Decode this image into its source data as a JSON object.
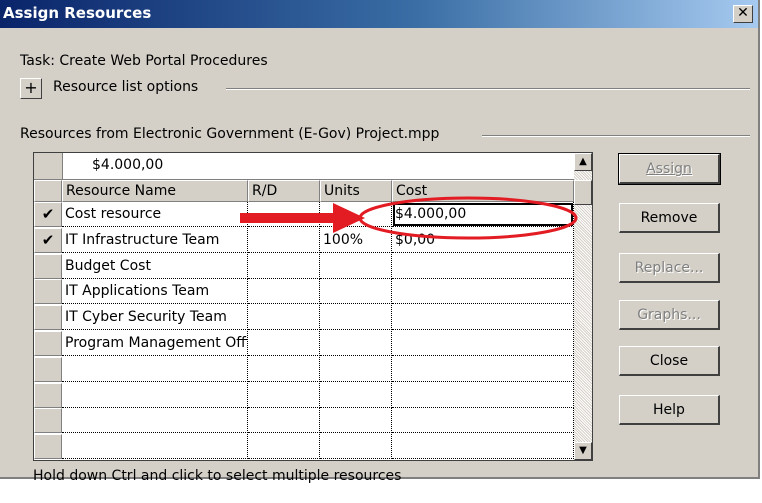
{
  "window": {
    "title": "Assign Resources",
    "close_glyph": "✕"
  },
  "task": {
    "label": "Task: Create Web Portal Procedures"
  },
  "options": {
    "expand_glyph": "+",
    "label": "Resource list options"
  },
  "resources_source": {
    "label": "Resources from Electronic Government (E-Gov) Project.mpp"
  },
  "grid": {
    "edit_value": "$4.000,00",
    "columns": [
      "Resource Name",
      "R/D",
      "Units",
      "Cost"
    ],
    "rows": [
      {
        "check": "✔",
        "name": "Cost resource",
        "rd": "",
        "units": "",
        "cost": "$4.000,00",
        "selected": true
      },
      {
        "check": "✔",
        "name": "IT Infrastructure Team",
        "rd": "",
        "units": "100%",
        "cost": "$0,00",
        "selected": false
      },
      {
        "check": "",
        "name": "Budget Cost",
        "rd": "",
        "units": "",
        "cost": "",
        "selected": false
      },
      {
        "check": "",
        "name": "IT Applications Team",
        "rd": "",
        "units": "",
        "cost": "",
        "selected": false
      },
      {
        "check": "",
        "name": "IT Cyber Security Team",
        "rd": "",
        "units": "",
        "cost": "",
        "selected": false
      },
      {
        "check": "",
        "name": "Program Management Office",
        "rd": "",
        "units": "",
        "cost": "",
        "selected": false
      },
      {
        "check": "",
        "name": "",
        "rd": "",
        "units": "",
        "cost": "",
        "selected": false
      },
      {
        "check": "",
        "name": "",
        "rd": "",
        "units": "",
        "cost": "",
        "selected": false
      },
      {
        "check": "",
        "name": "",
        "rd": "",
        "units": "",
        "cost": "",
        "selected": false
      },
      {
        "check": "",
        "name": "",
        "rd": "",
        "units": "",
        "cost": "",
        "selected": false
      }
    ]
  },
  "buttons": {
    "assign": "Assign",
    "remove": "Remove",
    "replace": "Replace...",
    "graphs": "Graphs...",
    "close": "Close",
    "help": "Help"
  },
  "hint": "Hold down Ctrl and click to select multiple resources",
  "colors": {
    "title_start": "#0a246a",
    "title_end": "#a6caf0",
    "dialog_bg": "#d4d0c8",
    "annotation_red": "#e31b23"
  },
  "icons": {
    "scroll_up": "▲",
    "scroll_down": "▼"
  }
}
